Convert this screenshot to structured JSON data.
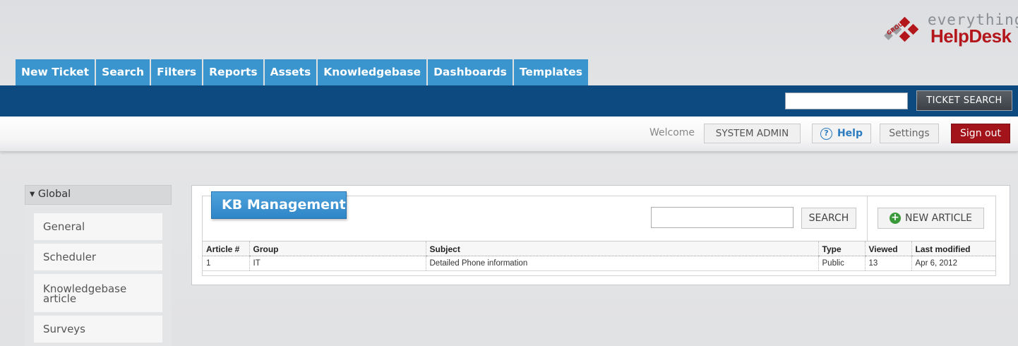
{
  "logo": {
    "everything": "everything",
    "helpdesk": "HelpDesk",
    "mark_text": "GROUP"
  },
  "tabs": [
    {
      "label": "New Ticket"
    },
    {
      "label": "Search"
    },
    {
      "label": "Filters"
    },
    {
      "label": "Reports"
    },
    {
      "label": "Assets"
    },
    {
      "label": "Knowledgebase"
    },
    {
      "label": "Dashboards"
    },
    {
      "label": "Templates"
    }
  ],
  "ticket_search": {
    "value": "",
    "button_label": "TICKET SEARCH"
  },
  "welcome": {
    "label": "Welcome",
    "user": "SYSTEM ADMIN",
    "help_label": "Help",
    "help_icon": "?",
    "settings_label": "Settings",
    "signout_label": "Sign out"
  },
  "sidebar": {
    "header": "Global",
    "header_icon": "▾",
    "items": [
      {
        "label": "General"
      },
      {
        "label": "Scheduler"
      },
      {
        "label": "Knowledgebase article"
      },
      {
        "label": "Surveys"
      }
    ]
  },
  "kb": {
    "title": "KB Management",
    "search_value": "",
    "search_button": "SEARCH",
    "new_article_button": "NEW ARTICLE",
    "new_article_icon": "+",
    "columns": [
      "Article #",
      "Group",
      "Subject",
      "Type",
      "Viewed",
      "Last modified"
    ],
    "rows": [
      {
        "article": "1",
        "group": "IT",
        "subject": "Detailed Phone information",
        "type": "Public",
        "viewed": "13",
        "modified": "Apr 6, 2012"
      }
    ]
  },
  "colors": {
    "tab_blue": "#3a95cf",
    "nav_bar": "#0c4a80",
    "signout_red": "#a3141a",
    "brand_red": "#b3171c"
  }
}
